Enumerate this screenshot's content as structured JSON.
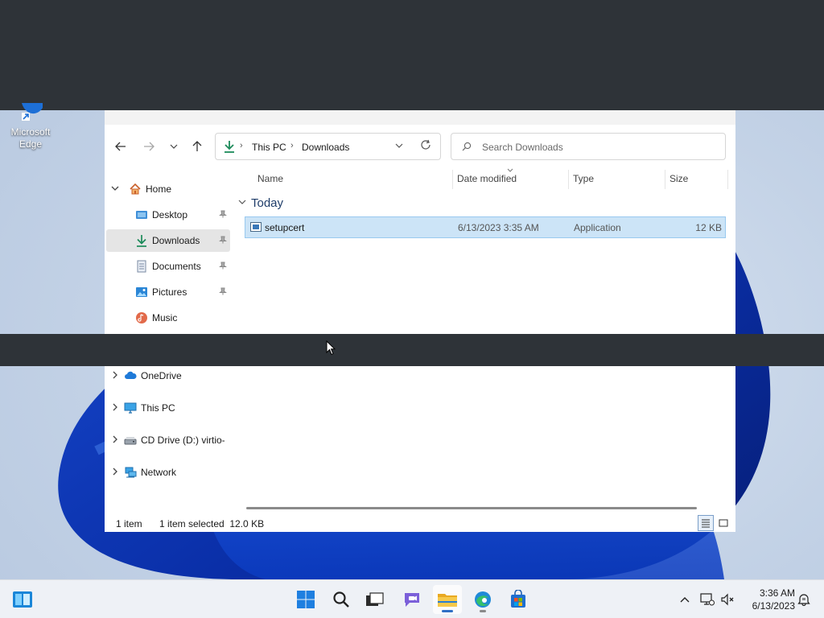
{
  "desktop": {
    "icons": [
      {
        "label": "Microsoft Edge"
      }
    ]
  },
  "explorer": {
    "address": {
      "crumbs": [
        "This PC",
        "Downloads"
      ]
    },
    "search": {
      "placeholder": "Search Downloads"
    },
    "sidebar": {
      "home": "Home",
      "quick_access": [
        {
          "label": "Desktop",
          "pinned": true
        },
        {
          "label": "Downloads",
          "pinned": true,
          "selected": true
        },
        {
          "label": "Documents",
          "pinned": true
        },
        {
          "label": "Pictures",
          "pinned": true
        },
        {
          "label": "Music",
          "pinned": false
        }
      ],
      "roots": [
        {
          "label": "OneDrive"
        },
        {
          "label": "This PC"
        },
        {
          "label": "CD Drive (D:) virtio-win"
        },
        {
          "label": "Network"
        }
      ]
    },
    "columns": [
      "Name",
      "Date modified",
      "Type",
      "Size"
    ],
    "group": "Today",
    "files": [
      {
        "name": "setupcert",
        "date_modified": "6/13/2023 3:35 AM",
        "type": "Application",
        "size": "12 KB"
      }
    ],
    "status": {
      "count": "1 item",
      "selection": "1 item selected  12.0 KB"
    }
  },
  "taskbar": {
    "clock_time": "3:36 AM",
    "clock_date": "6/13/2023"
  },
  "colors": {
    "accent": "#2f6fc5",
    "selection_bg": "#cce4f7",
    "selection_border": "#99c9ef",
    "overlay_band": "#2e3338"
  }
}
